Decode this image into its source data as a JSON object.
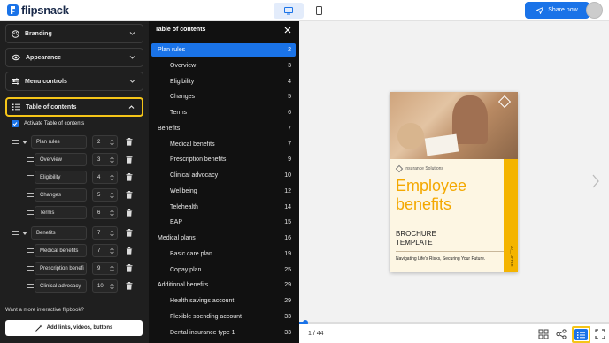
{
  "app": {
    "logo_text": "flipsnack",
    "share_label": "Share now"
  },
  "left_panel": {
    "sections": [
      {
        "label": "Branding",
        "icon": "palette-icon"
      },
      {
        "label": "Appearance",
        "icon": "eye-icon"
      },
      {
        "label": "Menu controls",
        "icon": "sliders-icon"
      },
      {
        "label": "Table of contents",
        "icon": "list-icon"
      }
    ],
    "activate_label": "Activate Table of contents",
    "toc_rows": [
      {
        "title": "Plan rules",
        "page": "2"
      },
      {
        "title": "Overview",
        "page": "3"
      },
      {
        "title": "Eligibility",
        "page": "4"
      },
      {
        "title": "Changes",
        "page": "5"
      },
      {
        "title": "Terms",
        "page": "6"
      },
      {
        "title": "Benefits",
        "page": "7"
      },
      {
        "title": "Medical benefits",
        "page": "7"
      },
      {
        "title": "Prescription benefi",
        "page": "9"
      },
      {
        "title": "Clinical advocacy",
        "page": "10"
      }
    ],
    "bottom_text": "Want a more interactive flipbook?",
    "add_links_label": "Add links, videos, buttons"
  },
  "toc": {
    "title": "Table of contents",
    "items": [
      {
        "label": "Plan rules",
        "page": "2"
      },
      {
        "label": "Overview",
        "page": "3"
      },
      {
        "label": "Eligibility",
        "page": "4"
      },
      {
        "label": "Changes",
        "page": "5"
      },
      {
        "label": "Terms",
        "page": "6"
      },
      {
        "label": "Benefits",
        "page": "7"
      },
      {
        "label": "Medical benefits",
        "page": "7"
      },
      {
        "label": "Prescription benefits",
        "page": "9"
      },
      {
        "label": "Clinical advocacy",
        "page": "10"
      },
      {
        "label": "Wellbeing",
        "page": "12"
      },
      {
        "label": "Telehealth",
        "page": "14"
      },
      {
        "label": "EAP",
        "page": "15"
      },
      {
        "label": "Medical plans",
        "page": "16"
      },
      {
        "label": "Basic care plan",
        "page": "19"
      },
      {
        "label": "Copay plan",
        "page": "25"
      },
      {
        "label": "Additional benefits",
        "page": "29"
      },
      {
        "label": "Health savings account",
        "page": "29"
      },
      {
        "label": "Flexible spending account",
        "page": "33"
      },
      {
        "label": "Dental insurance type 1",
        "page": "33"
      }
    ]
  },
  "cover": {
    "company": "Insurance Solutions",
    "title_line1": "Employee",
    "title_line2": "benefits",
    "subtitle_line1": "BROCHURE",
    "subtitle_line2": "TEMPLATE",
    "tagline": "Navigating Life's Risks, Securing Your Future.",
    "side_text": "20__ OFFER"
  },
  "viewer": {
    "page_indicator": "1 / 44",
    "progress": 0.02
  },
  "colors": {
    "accent": "#1a73e8",
    "highlight": "#f5c518",
    "cover_orange": "#f4a800"
  }
}
